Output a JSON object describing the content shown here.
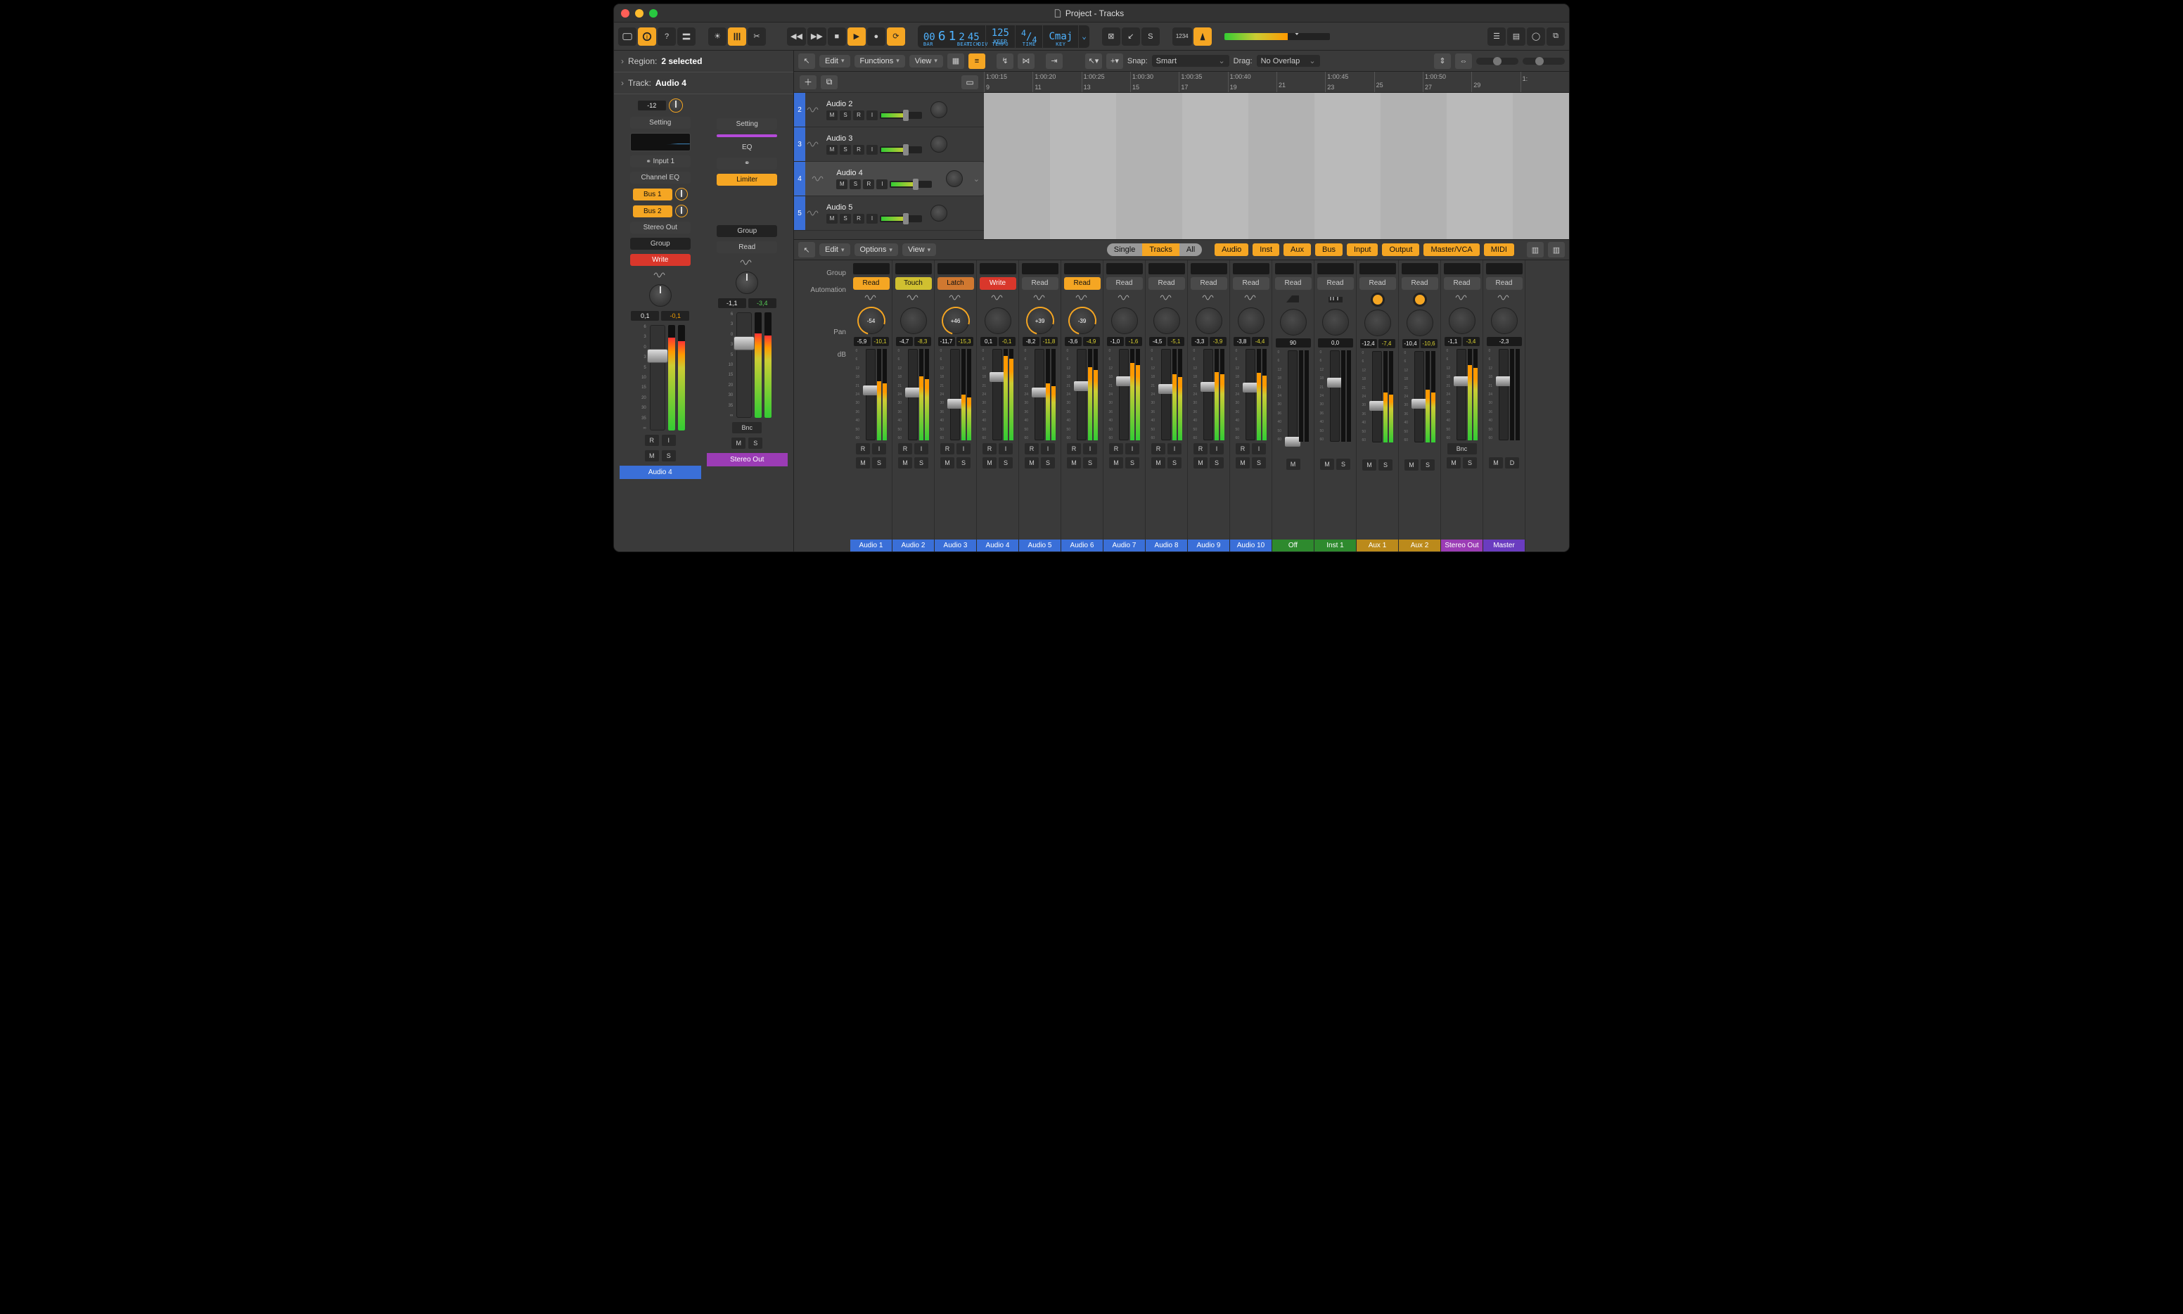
{
  "window_title": "Project - Tracks",
  "region_header": {
    "label": "Region:",
    "value": "2 selected"
  },
  "track_header": {
    "label": "Track:",
    "value": "Audio 4"
  },
  "transport": {
    "bar": "00",
    "beat_big": "6",
    "beat_sub": "1",
    "div": "2",
    "tick": "45",
    "bar_lab": "BAR",
    "beat_lab": "BEAT",
    "div_lab": "DIV",
    "tick_lab": "TICK",
    "tempo": "125",
    "tempo_sub": "KEEP",
    "tempo_lab": "TEMPO",
    "sig_top": "4",
    "sig_bot": "4",
    "time_lab": "TIME",
    "key": "Cmaj",
    "key_lab": "KEY",
    "count_in": "1234"
  },
  "arrange_menus": {
    "edit": "Edit",
    "functions": "Functions",
    "view": "View",
    "snap_lab": "Snap:",
    "snap_val": "Smart",
    "drag_lab": "Drag:",
    "drag_val": "No Overlap"
  },
  "ruler": [
    {
      "t": "1:00:15",
      "b": "9"
    },
    {
      "t": "1:00:20",
      "b": "11"
    },
    {
      "t": "1:00:25",
      "b": "13"
    },
    {
      "t": "1:00:30",
      "b": "15"
    },
    {
      "t": "1:00:35",
      "b": "17"
    },
    {
      "t": "1:00:40",
      "b": "19"
    },
    {
      "t": "",
      "b": "21"
    },
    {
      "t": "1:00:45",
      "b": "23"
    },
    {
      "t": "",
      "b": "25"
    },
    {
      "t": "1:00:50",
      "b": "27"
    },
    {
      "t": "",
      "b": "29"
    },
    {
      "t": "1:",
      "b": ""
    }
  ],
  "tracks": [
    {
      "num": "2",
      "name": "Audio 2",
      "sel": false
    },
    {
      "num": "3",
      "name": "Audio 3",
      "sel": false
    },
    {
      "num": "4",
      "name": "Audio 4",
      "sel": true
    },
    {
      "num": "5",
      "name": "Audio 5",
      "sel": false
    }
  ],
  "inspector": {
    "left": {
      "gain": "-12",
      "setting": "Setting",
      "input": "Input 1",
      "plug1": "Channel EQ",
      "send1": "Bus 1",
      "send2": "Bus 2",
      "output": "Stereo Out",
      "group": "Group",
      "auto": "Write",
      "db": "0,1",
      "peak": "-0,1",
      "ri_r": "R",
      "ri_i": "I",
      "m": "M",
      "s": "S",
      "label": "Audio 4"
    },
    "right": {
      "setting": "Setting",
      "eq": "EQ",
      "plug1": "Limiter",
      "group": "Group",
      "auto": "Read",
      "db": "-1,1",
      "peak": "-3,4",
      "bnc": "Bnc",
      "m": "M",
      "s": "S",
      "label": "Stereo Out"
    }
  },
  "mixer_bar": {
    "edit": "Edit",
    "options": "Options",
    "view": "View",
    "seg_single": "Single",
    "seg_tracks": "Tracks",
    "seg_all": "All",
    "cat_audio": "Audio",
    "cat_inst": "Inst",
    "cat_aux": "Aux",
    "cat_bus": "Bus",
    "cat_input": "Input",
    "cat_output": "Output",
    "cat_master": "Master/VCA",
    "cat_midi": "MIDI"
  },
  "mixer_labels": {
    "group": "Group",
    "automation": "Automation",
    "pan": "Pan",
    "db": "dB"
  },
  "track_btns": {
    "m": "M",
    "s": "S",
    "r": "R",
    "i": "I"
  },
  "channels": [
    {
      "name": "Audio 1",
      "auto": "Read",
      "auto_cls": "a-read",
      "pan": "-54",
      "pan_ring": true,
      "db": "-5,9",
      "pk": "-10,1",
      "fader": 40,
      "lvl": 65,
      "color": "cl-blue",
      "icon": "wave",
      "ri": true
    },
    {
      "name": "Audio 2",
      "auto": "Touch",
      "auto_cls": "a-touch",
      "pan": "",
      "pan_ring": false,
      "db": "-4,7",
      "pk": "-8,3",
      "fader": 42,
      "lvl": 70,
      "color": "cl-blue",
      "icon": "wave",
      "ri": true
    },
    {
      "name": "Audio 3",
      "auto": "Latch",
      "auto_cls": "a-latch",
      "pan": "+46",
      "pan_ring": true,
      "db": "-11,7",
      "pk": "-15,3",
      "fader": 55,
      "lvl": 50,
      "color": "cl-blue",
      "icon": "wave",
      "ri": true
    },
    {
      "name": "Audio 4",
      "auto": "Write",
      "auto_cls": "a-write",
      "pan": "",
      "pan_ring": false,
      "db": "0,1",
      "pk": "-0,1",
      "fader": 25,
      "lvl": 92,
      "color": "cl-blue",
      "icon": "wave",
      "ri": true
    },
    {
      "name": "Audio 5",
      "auto": "Read",
      "auto_cls": "a-off",
      "pan": "+39",
      "pan_ring": true,
      "db": "-8,2",
      "pk": "-11,8",
      "fader": 42,
      "lvl": 62,
      "color": "cl-blue",
      "icon": "wave",
      "ri": true
    },
    {
      "name": "Audio 6",
      "auto": "Read",
      "auto_cls": "a-read",
      "pan": "-39",
      "pan_ring": true,
      "db": "-3,6",
      "pk": "-4,9",
      "fader": 35,
      "lvl": 80,
      "color": "cl-blue",
      "icon": "wave",
      "ri": true
    },
    {
      "name": "Audio 7",
      "auto": "Read",
      "auto_cls": "a-off",
      "pan": "",
      "pan_ring": false,
      "db": "-1,0",
      "pk": "-1,6",
      "fader": 30,
      "lvl": 85,
      "color": "cl-blue",
      "icon": "wave",
      "ri": true
    },
    {
      "name": "Audio 8",
      "auto": "Read",
      "auto_cls": "a-off",
      "pan": "",
      "pan_ring": false,
      "db": "-4,5",
      "pk": "-5,1",
      "fader": 38,
      "lvl": 72,
      "color": "cl-blue",
      "icon": "wave",
      "ri": true
    },
    {
      "name": "Audio 9",
      "auto": "Read",
      "auto_cls": "a-off",
      "pan": "",
      "pan_ring": false,
      "db": "-3,3",
      "pk": "-3,9",
      "fader": 36,
      "lvl": 75,
      "color": "cl-blue",
      "icon": "wave",
      "ri": true
    },
    {
      "name": "Audio 10",
      "auto": "Read",
      "auto_cls": "a-off",
      "pan": "",
      "pan_ring": false,
      "db": "-3,8",
      "pk": "-4,4",
      "fader": 37,
      "lvl": 74,
      "color": "cl-blue",
      "icon": "wave",
      "ri": true
    },
    {
      "name": "Off",
      "auto": "Read",
      "auto_cls": "a-off",
      "pan": "",
      "pan_ring": false,
      "db": "90",
      "pk": "",
      "fader": 95,
      "lvl": 0,
      "color": "cl-green",
      "icon": "piano",
      "ri": false,
      "solo_only": true
    },
    {
      "name": "Inst 1",
      "auto": "Read",
      "auto_cls": "a-off",
      "pan": "",
      "pan_ring": false,
      "db": "0,0",
      "pk": "",
      "fader": 30,
      "lvl": 0,
      "color": "cl-green",
      "icon": "keys",
      "ri": false
    },
    {
      "name": "Aux 1",
      "auto": "Read",
      "auto_cls": "a-off",
      "pan": "",
      "pan_ring": false,
      "db": "-12,4",
      "pk": "-7,4",
      "fader": 55,
      "lvl": 55,
      "color": "cl-gold",
      "icon": "aux",
      "ri": false
    },
    {
      "name": "Aux 2",
      "auto": "Read",
      "auto_cls": "a-off",
      "pan": "",
      "pan_ring": false,
      "db": "-10,4",
      "pk": "-10,6",
      "fader": 52,
      "lvl": 58,
      "color": "cl-gold",
      "icon": "aux",
      "ri": false
    },
    {
      "name": "Stereo Out",
      "auto": "Read",
      "auto_cls": "a-off",
      "pan": "",
      "pan_ring": false,
      "db": "-1,1",
      "pk": "-3,4",
      "fader": 30,
      "lvl": 82,
      "color": "cl-purple",
      "icon": "wave",
      "ri": false,
      "bnc": "Bnc"
    },
    {
      "name": "Master",
      "auto": "Read",
      "auto_cls": "a-off",
      "pan": "",
      "pan_ring": false,
      "db": "-2,3",
      "pk": "",
      "fader": 30,
      "lvl": 0,
      "color": "cl-violet",
      "icon": "wave",
      "ri": false,
      "md": true
    }
  ],
  "scale_large": [
    "6",
    "3",
    "0",
    "3",
    "5",
    "10",
    "15",
    "20",
    "30",
    "35",
    "∞"
  ],
  "scale_small": [
    "0",
    "6",
    "12",
    "18",
    "21",
    "24",
    "30",
    "36",
    "40",
    "50",
    "60"
  ]
}
